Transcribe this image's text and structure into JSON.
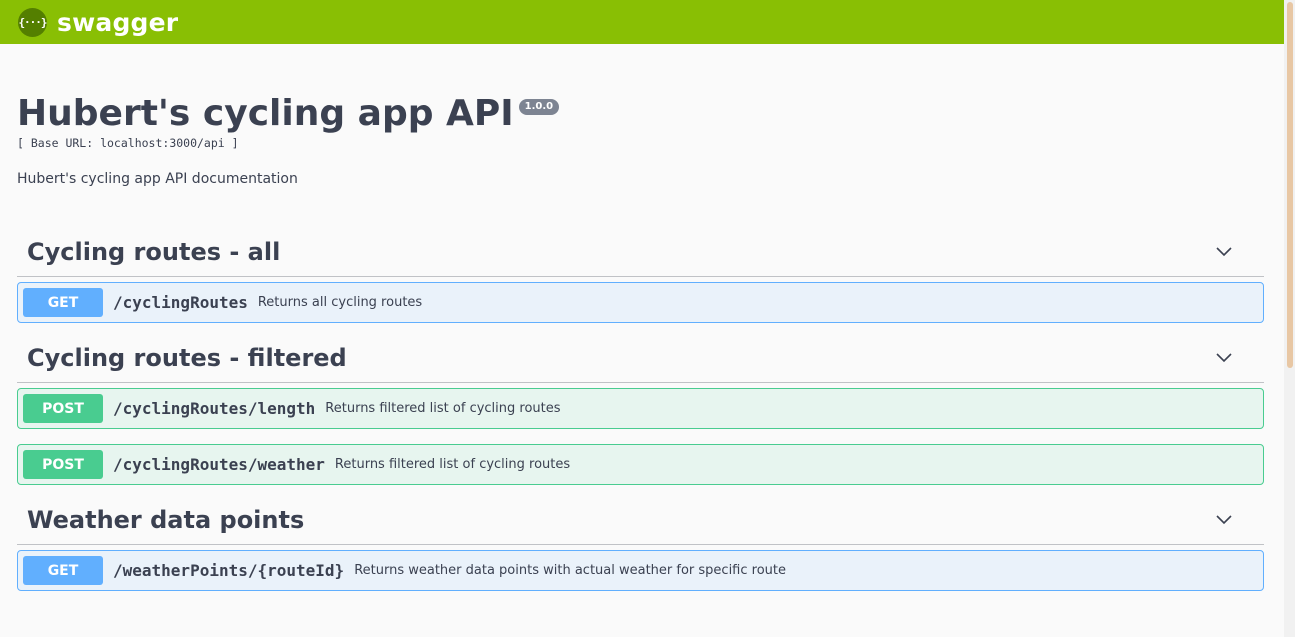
{
  "topbar": {
    "logo_glyph": "{···}",
    "brand": "swagger",
    "color": "#89bf04"
  },
  "info": {
    "title": "Hubert's cycling app API",
    "version": "1.0.0",
    "base_url": "[ Base URL: localhost:3000/api ]",
    "description": "Hubert's cycling app API documentation"
  },
  "sections": [
    {
      "title": "Cycling routes - all",
      "operations": [
        {
          "method": "GET",
          "path": "/cyclingRoutes",
          "summary": "Returns all cycling routes"
        }
      ]
    },
    {
      "title": "Cycling routes - filtered",
      "operations": [
        {
          "method": "POST",
          "path": "/cyclingRoutes/length",
          "summary": "Returns filtered list of cycling routes"
        },
        {
          "method": "POST",
          "path": "/cyclingRoutes/weather",
          "summary": "Returns filtered list of cycling routes"
        }
      ]
    },
    {
      "title": "Weather data points",
      "operations": [
        {
          "method": "GET",
          "path": "/weatherPoints/{routeId}",
          "summary": "Returns weather data points with actual weather for specific route"
        }
      ]
    }
  ],
  "colors": {
    "get": "#61affe",
    "post": "#49cc90"
  },
  "icons": {
    "logo": "swagger-logo-icon",
    "collapse": "chevron-down-icon"
  }
}
